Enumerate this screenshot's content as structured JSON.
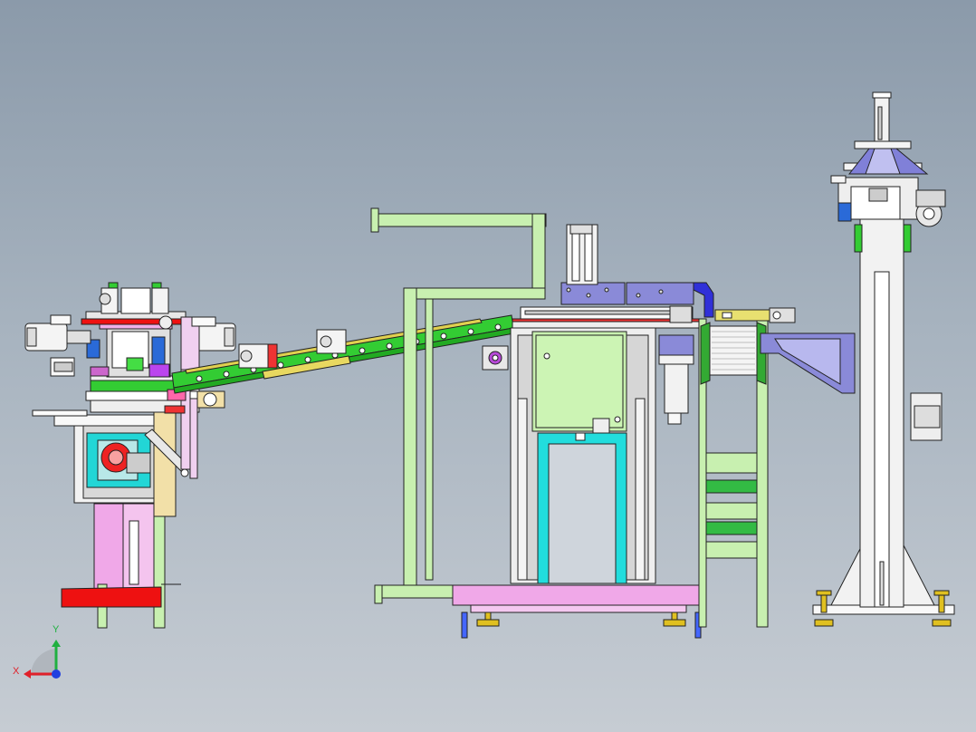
{
  "view": {
    "background_top": "#8b9aaa",
    "background_bottom": "#c6ccd3"
  },
  "triad": {
    "x_label": "X",
    "y_label": "Y",
    "x_color": "#e0202a",
    "y_color": "#20b040",
    "z_color": "#2040e0"
  },
  "colors": {
    "frame_green": "#c8f0b0",
    "conveyor_green": "#33cc33",
    "pink_base": "#f0a8e8",
    "cyan_frame": "#22dddd",
    "red_guard": "#ee1111",
    "purple_slide": "#8a8ad8",
    "yellow_bar": "#e8e070",
    "column_white": "#f2f2f2"
  }
}
